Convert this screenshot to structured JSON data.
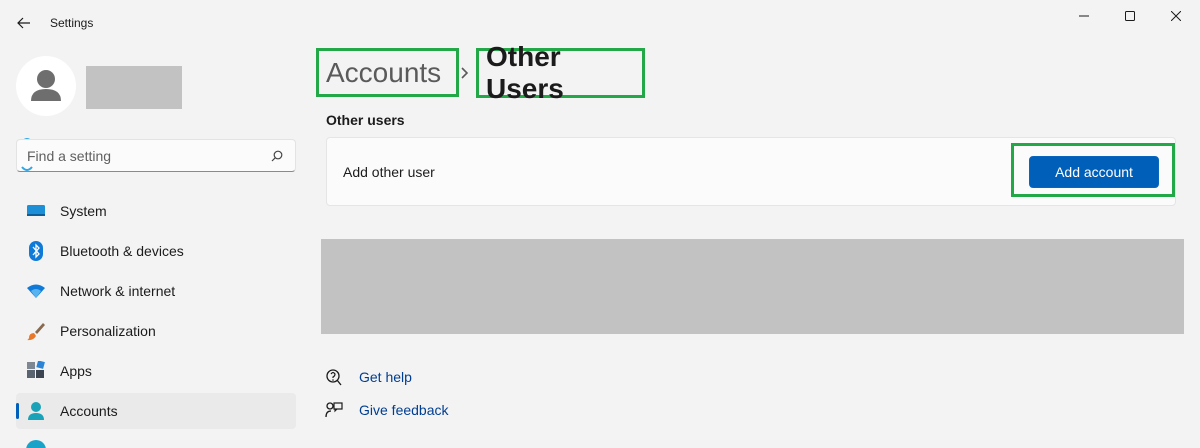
{
  "window": {
    "title": "Settings"
  },
  "search": {
    "placeholder": "Find a setting",
    "value": ""
  },
  "sidebar": {
    "items": [
      {
        "label": "System",
        "icon": "system-icon"
      },
      {
        "label": "Bluetooth & devices",
        "icon": "bluetooth-icon"
      },
      {
        "label": "Network & internet",
        "icon": "wifi-icon"
      },
      {
        "label": "Personalization",
        "icon": "paintbrush-icon"
      },
      {
        "label": "Apps",
        "icon": "apps-icon"
      },
      {
        "label": "Accounts",
        "icon": "person-icon",
        "active": true
      }
    ]
  },
  "breadcrumb": {
    "parent": "Accounts",
    "current": "Other Users"
  },
  "section": {
    "title": "Other users",
    "card_label": "Add other user",
    "add_button": "Add account"
  },
  "help": {
    "get_help": "Get help",
    "give_feedback": "Give feedback"
  },
  "colors": {
    "accent": "#005fb8",
    "highlight_border": "#22a847",
    "background": "#f3f3f3",
    "link": "#003e92"
  }
}
